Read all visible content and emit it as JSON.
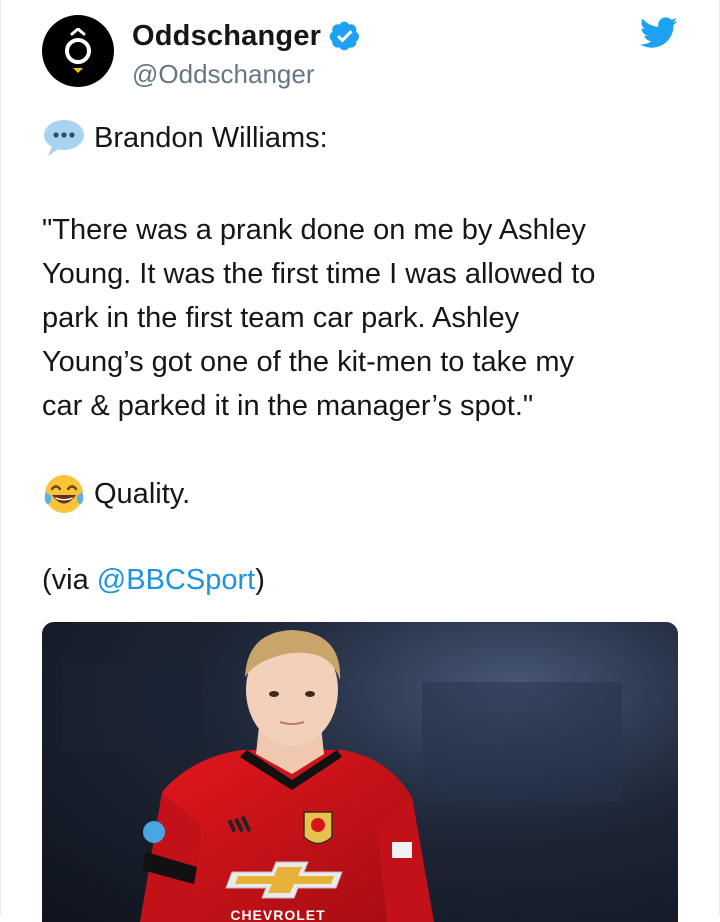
{
  "tweet": {
    "display_name": "Oddschanger",
    "handle": "@Oddschanger",
    "lines": {
      "intro": "Brandon Williams:",
      "quote_1": "\"There was a prank done on me by Ashley",
      "quote_2": "Young. It was the first time I was allowed to",
      "quote_3": "park in the first team car park. Ashley",
      "quote_4": "Young’s got one of the kit-men to take my",
      "quote_5": "car & parked it in the manager’s spot.\"",
      "reaction": "Quality.",
      "via_open": "(via ",
      "via_link": "@BBCSport",
      "via_close": ")"
    },
    "media": {
      "shirt_sponsor": "CHEVROLET"
    }
  },
  "icons": {
    "avatar": "oddschanger-logo-icon",
    "verified": "verified-badge-icon",
    "twitter": "twitter-bird-icon",
    "speech": "speech-balloon-icon",
    "laugh": "tears-of-joy-icon"
  },
  "colors": {
    "link": "#1b95e0",
    "verified": "#1da1f2",
    "handle": "#657786",
    "shirt": "#d8141a"
  }
}
